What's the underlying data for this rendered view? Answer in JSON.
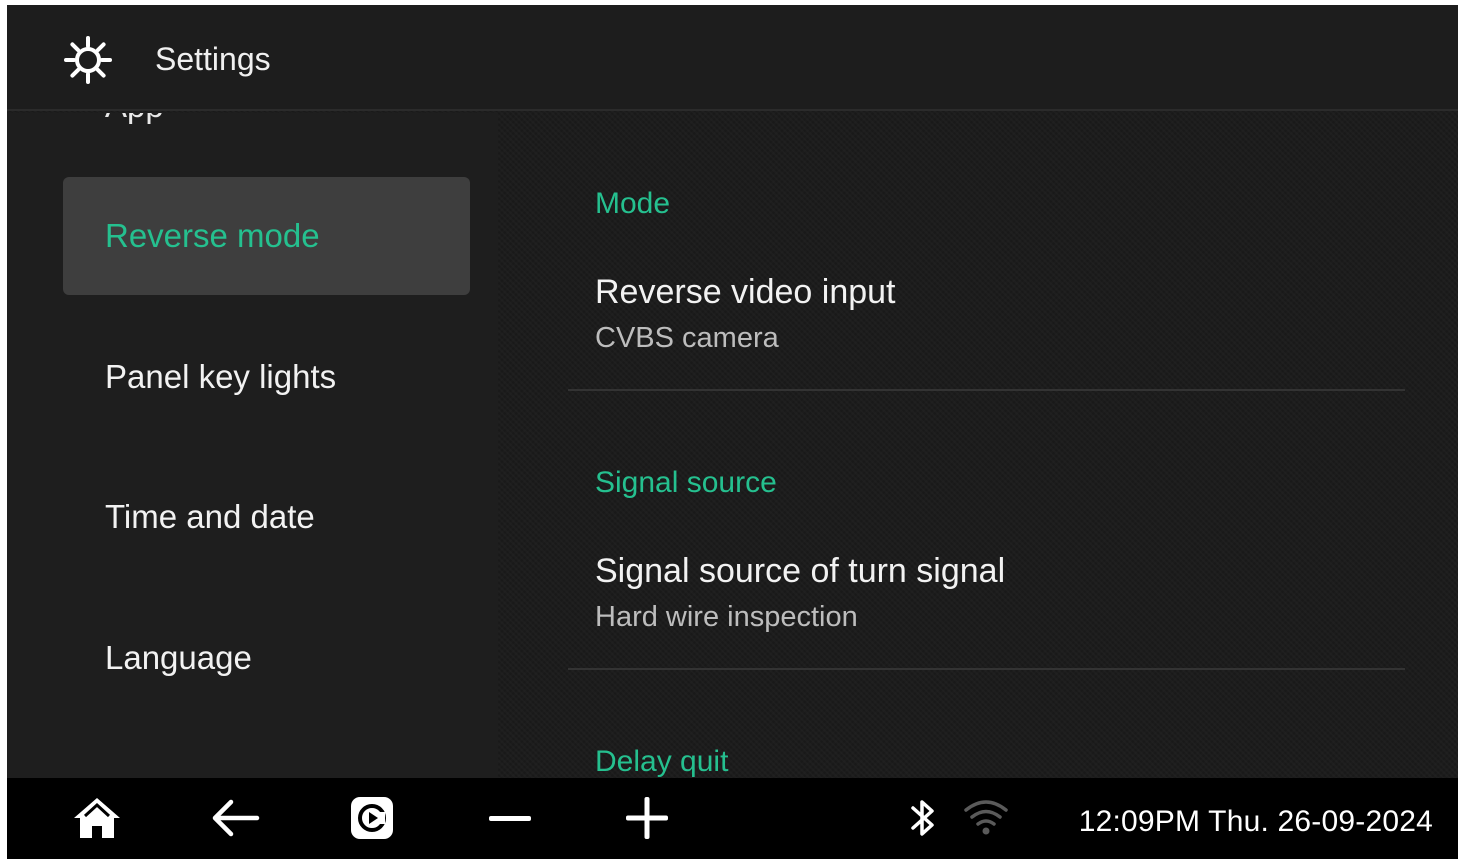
{
  "header": {
    "title": "Settings",
    "icon": "gear-icon"
  },
  "sidebar": {
    "clipped_item": "App",
    "items": [
      {
        "label": "Reverse mode",
        "active": true
      },
      {
        "label": "Panel key lights",
        "active": false
      },
      {
        "label": "Time and date",
        "active": false
      },
      {
        "label": "Language",
        "active": false
      }
    ]
  },
  "content": {
    "sections": [
      {
        "title": "Mode",
        "rows": [
          {
            "title": "Reverse video input",
            "value": "CVBS camera"
          }
        ]
      },
      {
        "title": "Signal source",
        "rows": [
          {
            "title": "Signal source of turn signal",
            "value": "Hard wire inspection"
          }
        ]
      },
      {
        "title": "Delay quit"
      }
    ]
  },
  "statusbar": {
    "icons": [
      "home-icon",
      "back-icon",
      "carplay-icon",
      "volume-down-icon",
      "volume-up-icon",
      "bluetooth-icon",
      "wifi-icon"
    ],
    "clock": "12:09PM Thu. 26-09-2024"
  },
  "colors": {
    "accent": "#25c08f",
    "active_bg": "#3e3e3e",
    "background": "#1c1c1c",
    "bar": "#000000"
  }
}
